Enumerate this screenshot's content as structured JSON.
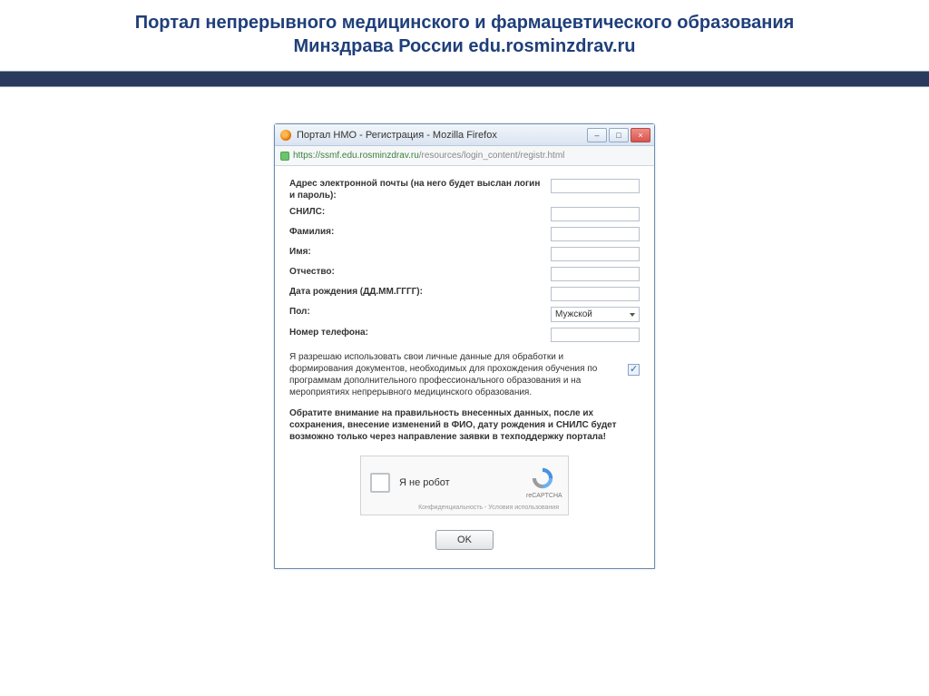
{
  "header": {
    "title_line1": "Портал непрерывного медицинского и фармацевтического образования",
    "title_line2": "Минздрава России edu.rosminzdrav.ru"
  },
  "window": {
    "title": "Портал НМО - Регистрация - Mozilla Firefox",
    "url_host": "https://ssmf.edu.rosminzdrav.ru",
    "url_path": "/resources/login_content/registr.html"
  },
  "form": {
    "email_label": "Адрес электронной почты (на него будет выслан логин и пароль):",
    "snils_label": "СНИЛС:",
    "surname_label": "Фамилия:",
    "name_label": "Имя:",
    "patronymic_label": "Отчество:",
    "dob_label": "Дата рождения (ДД.ММ.ГГГГ):",
    "gender_label": "Пол:",
    "gender_value": "Мужской",
    "phone_label": "Номер телефона:",
    "consent_text": "Я разрешаю использовать свои личные данные для обработки и формирования документов, необходимых для прохождения обучения по программам дополнительного профессионального образования и на мероприятиях непрерывного медицинского образования.",
    "warning_text": "Обратите внимание на правильность внесенных данных, после их сохранения, внесение изменений в ФИО, дату рождения и СНИЛС будет возможно только через направление заявки в техподдержку портала!",
    "consent_checked": true
  },
  "captcha": {
    "label": "Я не робот",
    "brand": "reCAPTCHA",
    "footer": "Конфиденциальность - Условия использования"
  },
  "buttons": {
    "ok": "OK"
  }
}
